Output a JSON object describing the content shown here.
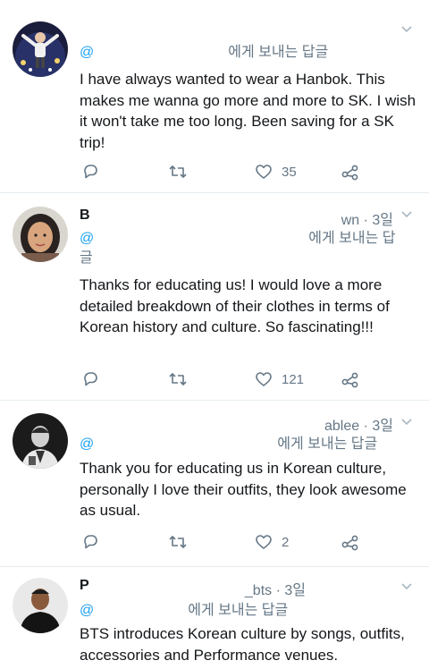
{
  "tweets": [
    {
      "name": "",
      "meta": "",
      "reply_handle": "@",
      "reply_suffix": "에게 보내는 답글",
      "text": "I have always wanted to wear a Hanbok. This makes me wanna go more and more to SK. I wish it won't take me too long. Been saving for a SK trip!",
      "likes": "35",
      "avatar": "purple-concert-photo"
    },
    {
      "name": "B",
      "meta": "wn · 3일",
      "reply_handle": "@",
      "reply_suffix": "에게 보내는 답글",
      "text": "Thanks for educating us! I would love a more detailed breakdown of their clothes in terms of Korean history and culture. So fascinating!!!",
      "likes": "121",
      "avatar": "woman-portrait"
    },
    {
      "name": "",
      "meta": "ablee · 3일",
      "reply_handle": "@",
      "reply_suffix": "에게 보내는 답글",
      "text": "Thank you for educating us in Korean culture, personally I love their outfits, they look awesome as usual.",
      "likes": "2",
      "avatar": "black-and-white-portrait"
    },
    {
      "name": "P",
      "meta": "_bts · 3일",
      "reply_handle": "@",
      "reply_suffix": "에게 보내는 답글",
      "text": "BTS introduces Korean culture by songs, outfits, accessories and Performance venues.",
      "likes": "",
      "avatar": "man-in-black-shirt"
    }
  ],
  "icons": [
    "reply-icon",
    "retweet-icon",
    "like-icon",
    "share-icon",
    "chevron-down-icon"
  ],
  "colors": {
    "muted": "#657786",
    "link": "#1da1f2",
    "divider": "#e6ecf0",
    "text": "#14171a"
  }
}
